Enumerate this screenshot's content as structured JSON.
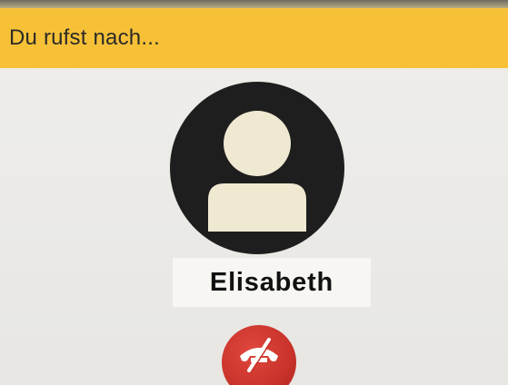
{
  "header": {
    "title": "Du rufst nach..."
  },
  "contact": {
    "name": "Elisabeth",
    "avatar_icon": "person-placeholder-icon"
  },
  "actions": {
    "hangup_icon": "hang-up-phone-icon"
  },
  "colors": {
    "header_bg": "#f7c137",
    "avatar_bg": "#1e1e1e",
    "avatar_figure": "#efe9d2",
    "hangup_bg": "#d23a31",
    "hangup_glyph": "#ffffff"
  }
}
